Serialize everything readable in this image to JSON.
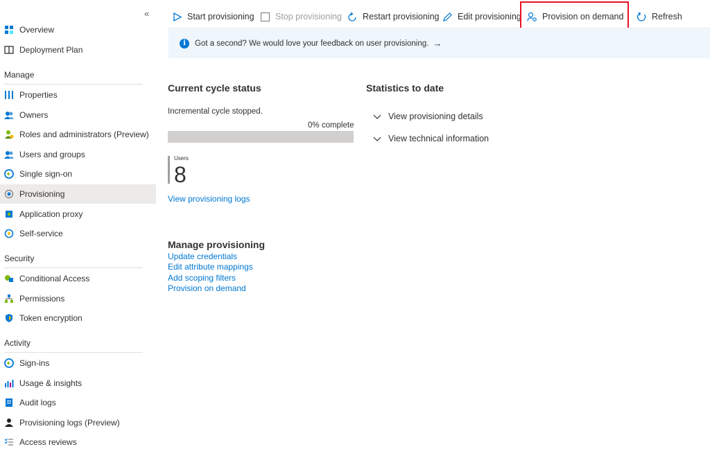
{
  "sidebar": {
    "collapse_glyph": "«",
    "items_top": [
      {
        "label": "Overview",
        "icon": "overview-icon"
      },
      {
        "label": "Deployment Plan",
        "icon": "book-icon"
      }
    ],
    "sections": [
      {
        "heading": "Manage",
        "items": [
          {
            "label": "Properties",
            "icon": "properties-icon"
          },
          {
            "label": "Owners",
            "icon": "owners-icon"
          },
          {
            "label": "Roles and administrators (Preview)",
            "icon": "roles-icon"
          },
          {
            "label": "Users and groups",
            "icon": "users-groups-icon"
          },
          {
            "label": "Single sign-on",
            "icon": "sso-icon"
          },
          {
            "label": "Provisioning",
            "icon": "provisioning-icon",
            "active": true
          },
          {
            "label": "Application proxy",
            "icon": "app-proxy-icon"
          },
          {
            "label": "Self-service",
            "icon": "self-service-icon"
          }
        ]
      },
      {
        "heading": "Security",
        "items": [
          {
            "label": "Conditional Access",
            "icon": "conditional-access-icon"
          },
          {
            "label": "Permissions",
            "icon": "permissions-icon"
          },
          {
            "label": "Token encryption",
            "icon": "shield-icon"
          }
        ]
      },
      {
        "heading": "Activity",
        "items": [
          {
            "label": "Sign-ins",
            "icon": "sign-ins-icon"
          },
          {
            "label": "Usage & insights",
            "icon": "insights-icon"
          },
          {
            "label": "Audit logs",
            "icon": "audit-logs-icon"
          },
          {
            "label": "Provisioning logs (Preview)",
            "icon": "provisioning-logs-icon"
          },
          {
            "label": "Access reviews",
            "icon": "access-reviews-icon"
          }
        ]
      }
    ]
  },
  "toolbar": {
    "start": "Start provisioning",
    "stop": "Stop provisioning",
    "restart": "Restart provisioning",
    "edit": "Edit provisioning",
    "on_demand": "Provision on demand",
    "refresh": "Refresh"
  },
  "banner": {
    "text": "Got a second? We would love your feedback on user provisioning.",
    "arrow": "→"
  },
  "cycle": {
    "title": "Current cycle status",
    "status": "Incremental cycle stopped.",
    "progress_label": "0% complete",
    "progress_fraction": 0,
    "users_label": "Users",
    "users_count": "8",
    "logs_link": "View provisioning logs"
  },
  "stats": {
    "title": "Statistics to date",
    "details": "View provisioning details",
    "technical": "View technical information"
  },
  "manage": {
    "title": "Manage provisioning",
    "links": [
      "Update credentials",
      "Edit attribute mappings",
      "Add scoping filters",
      "Provision on demand"
    ]
  },
  "colors": {
    "accent": "#0078d4",
    "highlight": "#e81123",
    "active_bg": "#edebe9"
  }
}
